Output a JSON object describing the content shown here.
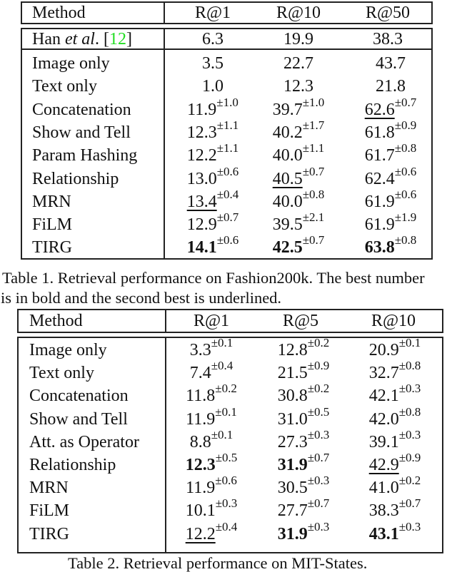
{
  "table1": {
    "header": [
      "Method",
      "R@1",
      "R@10",
      "R@50"
    ],
    "baseline_row": {
      "method_prefix": "Han ",
      "method_italic": "et al",
      "method_suffix": ". [",
      "citation": "12",
      "method_close": "]",
      "values": [
        "6.3",
        "19.9",
        "38.3"
      ]
    },
    "rows": [
      {
        "method": "Image only",
        "cells": [
          {
            "v": "3.5"
          },
          {
            "v": "22.7"
          },
          {
            "v": "43.7"
          }
        ]
      },
      {
        "method": "Text only",
        "cells": [
          {
            "v": "1.0"
          },
          {
            "v": "12.3"
          },
          {
            "v": "21.8"
          }
        ]
      },
      {
        "method": "Concatenation",
        "cells": [
          {
            "v": "11.9",
            "sd": "±1.0"
          },
          {
            "v": "39.7",
            "sd": "±1.0"
          },
          {
            "v": "62.6",
            "sd": "±0.7",
            "style": "underline"
          }
        ]
      },
      {
        "method": "Show and Tell",
        "cells": [
          {
            "v": "12.3",
            "sd": "±1.1"
          },
          {
            "v": "40.2",
            "sd": "±1.7"
          },
          {
            "v": "61.8",
            "sd": "±0.9"
          }
        ]
      },
      {
        "method": "Param Hashing",
        "cells": [
          {
            "v": "12.2",
            "sd": "±1.1"
          },
          {
            "v": "40.0",
            "sd": "±1.1"
          },
          {
            "v": "61.7",
            "sd": "±0.8"
          }
        ]
      },
      {
        "method": "Relationship",
        "cells": [
          {
            "v": "13.0",
            "sd": "±0.6"
          },
          {
            "v": "40.5",
            "sd": "±0.7",
            "style": "underline"
          },
          {
            "v": "62.4",
            "sd": "±0.6"
          }
        ]
      },
      {
        "method": "MRN",
        "cells": [
          {
            "v": "13.4",
            "sd": "±0.4",
            "style": "underline"
          },
          {
            "v": "40.0",
            "sd": "±0.8"
          },
          {
            "v": "61.9",
            "sd": "±0.6"
          }
        ]
      },
      {
        "method": "FiLM",
        "cells": [
          {
            "v": "12.9",
            "sd": "±0.7"
          },
          {
            "v": "39.5",
            "sd": "±2.1"
          },
          {
            "v": "61.9",
            "sd": "±1.9"
          }
        ]
      },
      {
        "method": "TIRG",
        "cells": [
          {
            "v": "14.1",
            "sd": "±0.6",
            "style": "bold"
          },
          {
            "v": "42.5",
            "sd": "±0.7",
            "style": "bold"
          },
          {
            "v": "63.8",
            "sd": "±0.8",
            "style": "bold"
          }
        ]
      }
    ],
    "caption_line1": "Table 1. Retrieval performance on Fashion200k.  The best number",
    "caption_line2": "is in bold and the second best is underlined."
  },
  "table2": {
    "header": [
      "Method",
      "R@1",
      "R@5",
      "R@10"
    ],
    "rows": [
      {
        "method": "Image only",
        "cells": [
          {
            "v": "3.3",
            "sd": "±0.1"
          },
          {
            "v": "12.8",
            "sd": "±0.2"
          },
          {
            "v": "20.9",
            "sd": "±0.1"
          }
        ]
      },
      {
        "method": "Text only",
        "cells": [
          {
            "v": "7.4",
            "sd": "±0.4"
          },
          {
            "v": "21.5",
            "sd": "±0.9"
          },
          {
            "v": "32.7",
            "sd": "±0.8"
          }
        ]
      },
      {
        "method": "Concatenation",
        "cells": [
          {
            "v": "11.8",
            "sd": "±0.2"
          },
          {
            "v": "30.8",
            "sd": "±0.2"
          },
          {
            "v": "42.1",
            "sd": "±0.3"
          }
        ]
      },
      {
        "method": "Show and Tell",
        "cells": [
          {
            "v": "11.9",
            "sd": "±0.1"
          },
          {
            "v": "31.0",
            "sd": "±0.5"
          },
          {
            "v": "42.0",
            "sd": "±0.8"
          }
        ]
      },
      {
        "method": "Att. as Operator",
        "cells": [
          {
            "v": "8.8",
            "sd": "±0.1"
          },
          {
            "v": "27.3",
            "sd": "±0.3"
          },
          {
            "v": "39.1",
            "sd": "±0.3"
          }
        ]
      },
      {
        "method": "Relationship",
        "cells": [
          {
            "v": "12.3",
            "sd": "±0.5",
            "style": "bold"
          },
          {
            "v": "31.9",
            "sd": "±0.7",
            "style": "bold"
          },
          {
            "v": "42.9",
            "sd": "±0.9",
            "style": "underline"
          }
        ]
      },
      {
        "method": "MRN",
        "cells": [
          {
            "v": "11.9",
            "sd": "±0.6"
          },
          {
            "v": "30.5",
            "sd": "±0.3"
          },
          {
            "v": "41.0",
            "sd": "±0.2"
          }
        ]
      },
      {
        "method": "FiLM",
        "cells": [
          {
            "v": "10.1",
            "sd": "±0.3"
          },
          {
            "v": "27.7",
            "sd": "±0.7"
          },
          {
            "v": "38.3",
            "sd": "±0.7"
          }
        ]
      },
      {
        "method": "TIRG",
        "cells": [
          {
            "v": "12.2",
            "sd": "±0.4",
            "style": "underline"
          },
          {
            "v": "31.9",
            "sd": "±0.3",
            "style": "bold"
          },
          {
            "v": "43.1",
            "sd": "±0.3",
            "style": "bold"
          }
        ]
      }
    ],
    "caption": "Table 2. Retrieval performance on MIT-States."
  },
  "colors": {
    "citation": "#22dd22",
    "rule": "#222222",
    "text": "#111111"
  }
}
